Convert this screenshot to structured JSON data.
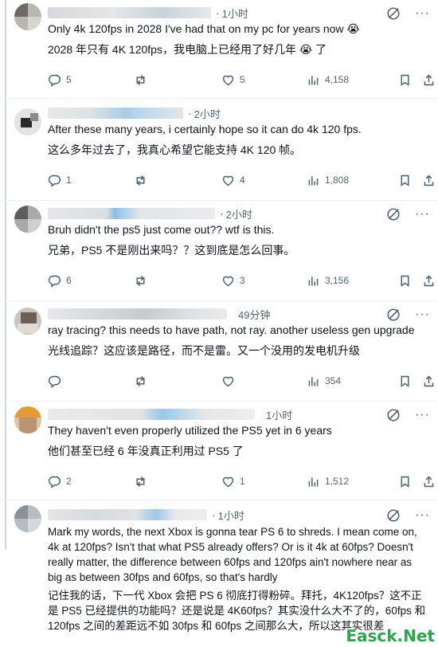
{
  "colors": {
    "text": "#0f1419",
    "muted": "#536471",
    "divider": "#eff3f4",
    "thread_line": "#cfd9de",
    "watermark": "#2ea44f"
  },
  "icons": {
    "reply": "speech-bubble-icon",
    "repost": "repost-arrows-icon",
    "like": "heart-icon",
    "views": "bar-chart-icon",
    "bookmark": "bookmark-icon",
    "share": "share-upload-icon",
    "grok": "grok-slash-circle-icon",
    "more": "more-dots-icon"
  },
  "replies": [
    {
      "time": "1小时",
      "text_en": "Only 4k 120fps in 2028 I've had that on my pc for years now 😭",
      "text_zh": "2028 年只有 4K 120fps，我电脑上已经用了好几年 😭 了",
      "reply_count": "5",
      "repost_count": "",
      "like_count": "5",
      "views": "4,158"
    },
    {
      "time": "2小时",
      "text_en": "After these many years, i certainly hope so it can do 4k 120 fps.",
      "text_zh": "这么多年过去了，我真心希望它能支持 4K 120 帧。",
      "reply_count": "1",
      "repost_count": "",
      "like_count": "4",
      "views": "1,808"
    },
    {
      "time": "2小时",
      "text_en": "Bruh didn't the ps5 just come out?? wtf is this.",
      "text_zh": "兄弟，PS5 不是刚出来吗？？这到底是怎么回事。",
      "reply_count": "6",
      "repost_count": "",
      "like_count": "3",
      "views": "3,156"
    },
    {
      "time": "49分钟",
      "text_en": "ray tracing? this needs to have path, not ray. another useless gen upgrade",
      "text_zh": "光线追踪？这应该是路径，而不是雷。又一个没用的发电机升级",
      "reply_count": "",
      "repost_count": "",
      "like_count": "",
      "views": "354"
    },
    {
      "time": "1小时",
      "text_en": "They haven't even properly utilized the PS5 yet in 6 years",
      "text_zh": "他们甚至已经 6 年没真正利用过 PS5 了",
      "reply_count": "2",
      "repost_count": "",
      "like_count": "1",
      "views": "1,512"
    },
    {
      "time": "1小时",
      "text_en": "Mark my words, the next Xbox is gonna tear PS 6 to shreds. I mean come on, 4k at 120fps? Isn't that what PS5 already offers? Or is it 4k at 60fps? Doesn't really matter, the difference between 60fps and 120fps ain't nowhere near as big as between 30fps and 60fps, so that's hardly",
      "text_zh": "记住我的话，下一代 Xbox 会把 PS 6 彻底打得粉碎。拜托，4K120fps？这不正是 PS5 已经提供的功能吗？还是说是 4K60fps？其实没什么大不了的，60fps 和 120fps 之间的差距远不如 30fps 和 60fps 之间那么大，所以这其实很差"
    }
  ],
  "watermark": "Easck.Net"
}
